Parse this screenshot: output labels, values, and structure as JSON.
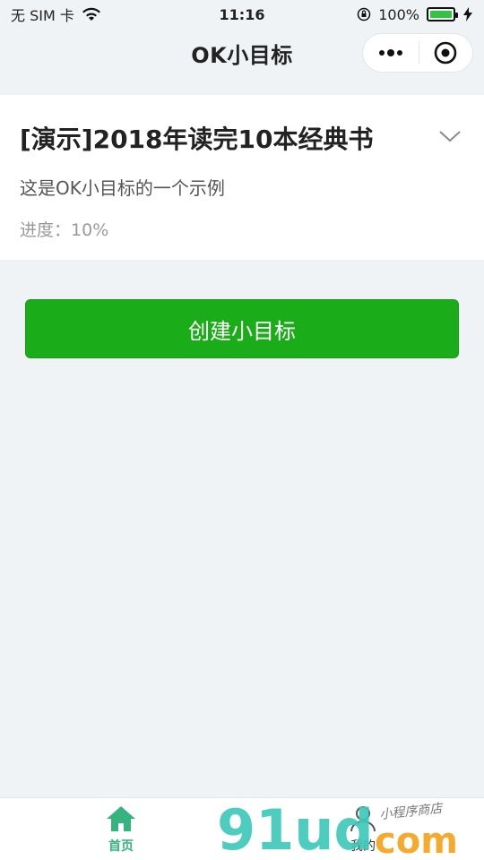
{
  "status": {
    "carrier": "无 SIM 卡",
    "time": "11:16",
    "battery": "100%",
    "battery_level": 1.0
  },
  "nav": {
    "title": "OK小目标"
  },
  "goal": {
    "title": "[演示]2018年读完10本经典书",
    "description": "这是OK小目标的一个示例",
    "progress_label": "进度：",
    "progress_value": "10%"
  },
  "actions": {
    "create_label": "创建小目标"
  },
  "tabs": [
    {
      "label": "首页",
      "icon": "home-icon",
      "active": true
    },
    {
      "label": "我的",
      "icon": "user-icon",
      "active": false
    }
  ],
  "watermark": {
    "brand": "91ud.com",
    "subtitle": "小程序商店"
  },
  "colors": {
    "primary_green": "#1aad19",
    "tab_active": "#36b37e",
    "background": "#eff3f5"
  }
}
